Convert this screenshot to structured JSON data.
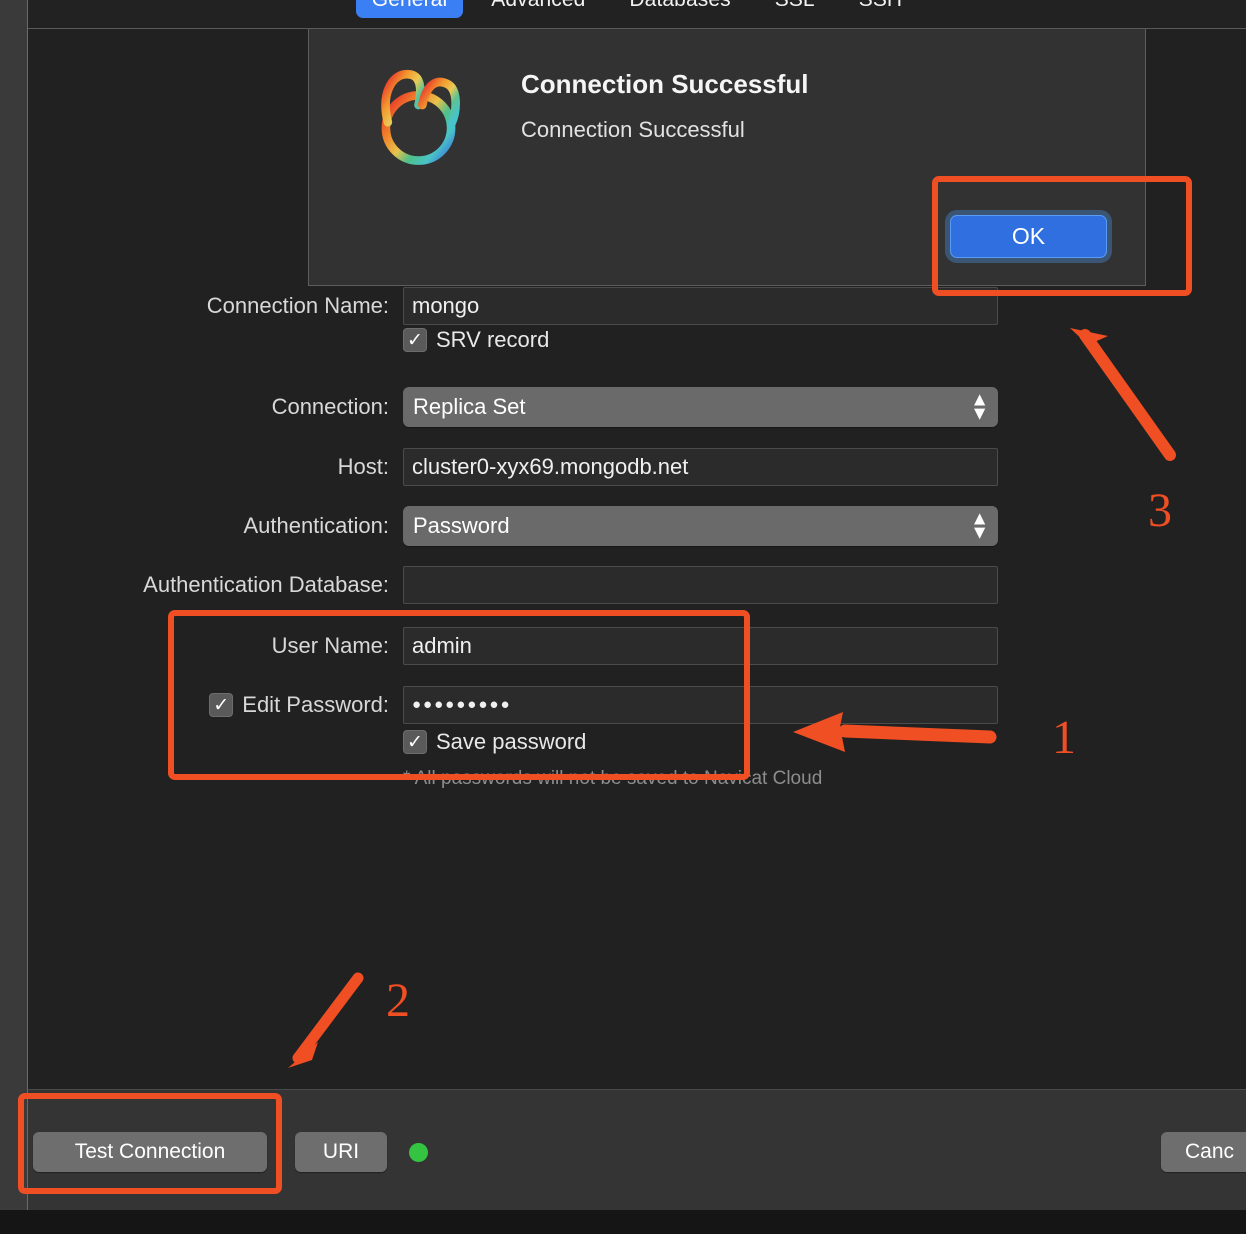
{
  "window": {
    "tabs": [
      {
        "label": "General",
        "selected": true
      },
      {
        "label": "Advanced",
        "selected": false
      },
      {
        "label": "Databases",
        "selected": false
      },
      {
        "label": "SSL",
        "selected": false
      },
      {
        "label": "SSH",
        "selected": false
      }
    ]
  },
  "form": {
    "connection_name": {
      "label": "Connection Name:",
      "value": "mongo"
    },
    "srv_record": {
      "label": "SRV record",
      "checked": true,
      "check_glyph": "✓"
    },
    "connection": {
      "label": "Connection:",
      "value": "Replica Set"
    },
    "host": {
      "label": "Host:",
      "value": "cluster0-xyx69.mongodb.net"
    },
    "authentication": {
      "label": "Authentication:",
      "value": "Password"
    },
    "authentication_database": {
      "label": "Authentication Database:",
      "value": ""
    },
    "user_name": {
      "label": "User Name:",
      "value": "admin"
    },
    "edit_password": {
      "label": "Edit Password:",
      "checked": true,
      "value": "●●●●●●●●●"
    },
    "save_password": {
      "label": "Save password",
      "checked": true
    },
    "note": "* All passwords will not be saved to Navicat Cloud"
  },
  "dialog": {
    "title": "Connection Successful",
    "message": "Connection Successful",
    "ok_label": "OK"
  },
  "bottom_bar": {
    "test_connection_label": "Test Connection",
    "uri_label": "URI",
    "cancel_label": "Canc",
    "status_dot_color": "#35c442"
  },
  "annotations": {
    "accent_color": "#f04e23",
    "marker_1": "1",
    "marker_2": "2",
    "marker_3": "3"
  }
}
